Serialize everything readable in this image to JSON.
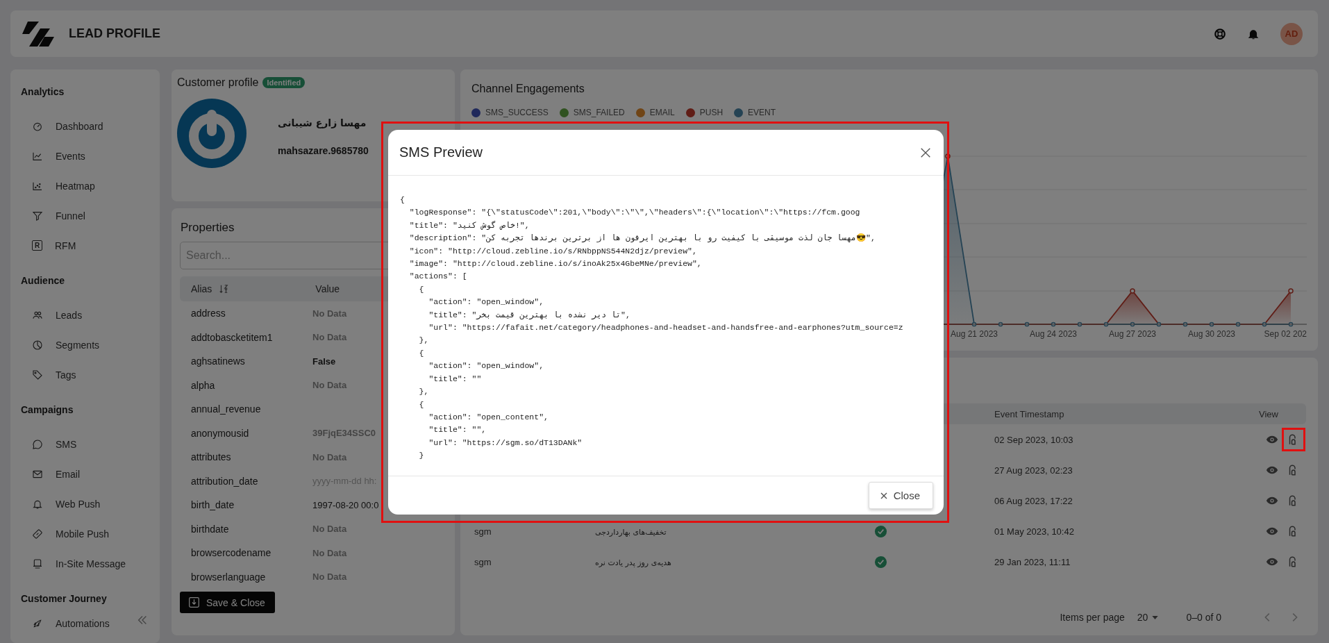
{
  "header": {
    "title": "LEAD PROFILE",
    "avatar_initials": "AD"
  },
  "sidebar": {
    "sections": [
      {
        "title": "Analytics",
        "items": [
          {
            "label": "Dashboard"
          },
          {
            "label": "Events"
          },
          {
            "label": "Heatmap"
          },
          {
            "label": "Funnel"
          },
          {
            "label": "RFM",
            "icon_text": "R"
          }
        ]
      },
      {
        "title": "Audience",
        "items": [
          {
            "label": "Leads"
          },
          {
            "label": "Segments"
          },
          {
            "label": "Tags"
          }
        ]
      },
      {
        "title": "Campaigns",
        "items": [
          {
            "label": "SMS"
          },
          {
            "label": "Email"
          },
          {
            "label": "Web Push"
          },
          {
            "label": "Mobile Push"
          },
          {
            "label": "In-Site Message"
          }
        ]
      },
      {
        "title": "Customer Journey",
        "items": [
          {
            "label": "Automations"
          }
        ]
      }
    ]
  },
  "profile": {
    "title": "Customer profile",
    "badge": "Identified",
    "name": "مهسا زارع شیبانی",
    "username": "mahsazare.9685780"
  },
  "properties": {
    "title": "Properties",
    "search": {
      "placeholder": "Search..."
    },
    "columns": [
      "Alias",
      "Value"
    ],
    "rows": [
      {
        "alias": "address",
        "value": "No Data",
        "kind": "muted"
      },
      {
        "alias": "addtobascketitem1",
        "value": "No Data",
        "kind": "muted"
      },
      {
        "alias": "aghsatinews",
        "value": "False",
        "kind": "strong"
      },
      {
        "alias": "alpha",
        "value": "No Data",
        "kind": "muted"
      },
      {
        "alias": "annual_revenue"
      },
      {
        "alias": "anonymousid",
        "value": "39FjqE34SSC0",
        "kind": "muted"
      },
      {
        "alias": "attributes",
        "value": "No Data",
        "kind": "muted"
      },
      {
        "alias": "attribution_date",
        "value": "yyyy-mm-dd hh:",
        "kind": "hint"
      },
      {
        "alias": "birth_date",
        "value": "1997-08-20 00:0",
        "kind": "plain"
      },
      {
        "alias": "birthdate",
        "value": "No Data",
        "kind": "muted"
      },
      {
        "alias": "browsercodename",
        "value": "No Data",
        "kind": "muted"
      },
      {
        "alias": "browserlanguage",
        "value": "No Data",
        "kind": "muted"
      }
    ],
    "save_button": "Save & Close"
  },
  "chart": {
    "title": "Channel Engagements",
    "legend": [
      {
        "label": "SMS_SUCCESS",
        "color": "#20295b"
      },
      {
        "label": "SMS_FAILED",
        "color": "#305220"
      },
      {
        "label": "EMAIL",
        "color": "#704516"
      },
      {
        "label": "PUSH",
        "color": "#601d16"
      },
      {
        "label": "EVENT",
        "color": "#254354"
      }
    ],
    "x_labels": [
      "Aug 21 2023",
      "Aug 24 2023",
      "Aug 27 2023",
      "Aug 30 2023",
      "Sep 02 202"
    ]
  },
  "events": {
    "columns": [
      "Event Timestamp",
      "View"
    ],
    "rows": [
      {
        "timestamp": "02 Sep 2023, 10:03",
        "marked": true
      },
      {
        "timestamp": "27 Aug 2023, 02:23",
        "marked": false
      },
      {
        "timestamp": "06 Aug 2023, 17:22",
        "marked": false
      },
      {
        "channel": "sgm",
        "title": "تخفیف‌های بهارداردجی",
        "delivered": true,
        "timestamp": "01 May 2023, 10:42",
        "marked": false
      },
      {
        "channel": "sgm",
        "title": "هدیه‌ی روز پدر یادت نره",
        "delivered": true,
        "timestamp": "29 Jan 2023, 11:11",
        "marked": false
      }
    ],
    "pagination": {
      "label": "Items per page",
      "page_size": "20",
      "range": "0–0 of 0",
      "prev_disabled": true,
      "next_disabled": true
    }
  },
  "modal": {
    "title": "SMS Preview",
    "marked": true,
    "close_button": "Close",
    "body_lines": [
      "{",
      "  \"logResponse\": \"{\\\"statusCode\\\":201,\\\"body\\\":\\\"\\\",\\\"headers\\\":{\\\"location\\\":\\\"https://fcm.goog",
      "  \"title\": \"خاص گوش کنید!\",",
      "  \"description\": \"مهسا جان لذت موسیقی با کیفیت رو با بهترین ایرفون ها از برترین برندها تجربه کن😎\",",
      "  \"icon\": \"http://cloud.zebline.io/s/RNbppNS544N2djz/preview\",",
      "  \"image\": \"http://cloud.zebline.io/s/inoAk25x4GbeMNe/preview\",",
      "  \"actions\": [",
      "    {",
      "      \"action\": \"open_window\",",
      "      \"title\": \"تا دیر نشده با بهترین قیمت بخر\",",
      "      \"url\": \"https://fafait.net/category/headphones-and-headset-and-handsfree-and-earphones?utm_source=z",
      "    },",
      "    {",
      "      \"action\": \"open_window\",",
      "      \"title\": \"\"",
      "    },",
      "    {",
      "      \"action\": \"open_content\",",
      "      \"title\": \"\",",
      "      \"url\": \"https://sgm.so/dT13DANk\"",
      "    }"
    ]
  }
}
